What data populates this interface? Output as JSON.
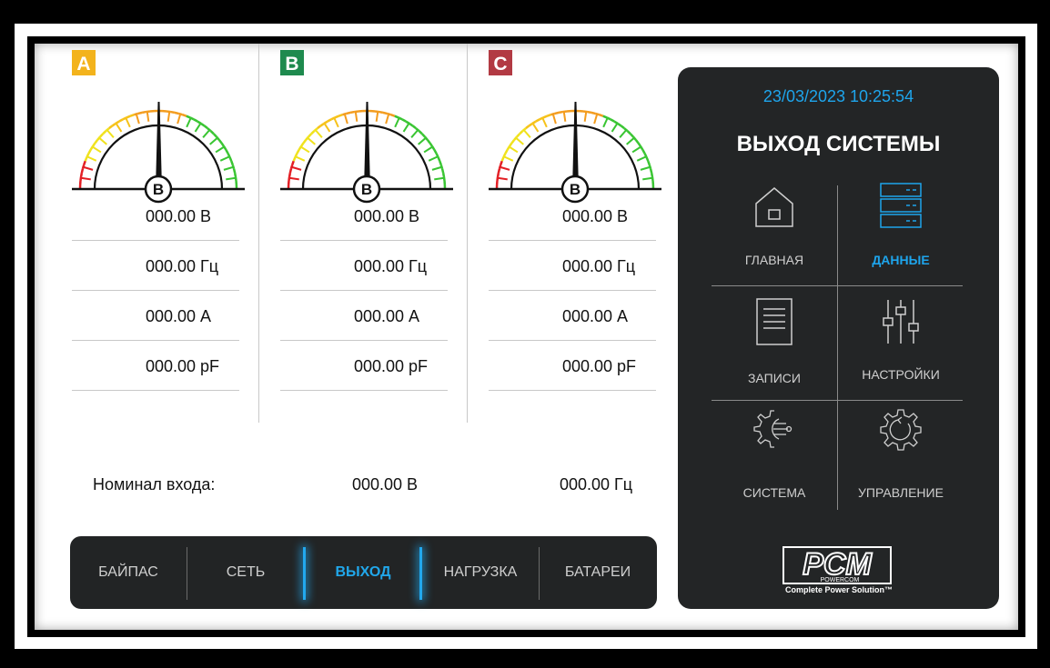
{
  "phases": [
    {
      "badge": "A",
      "color": "#f3b31c",
      "gauge_label": "B",
      "rows": [
        {
          "value": "000.00",
          "unit": "В"
        },
        {
          "value": "000.00",
          "unit": "Гц"
        },
        {
          "value": "000.00",
          "unit": "А"
        },
        {
          "value": "000.00",
          "unit": "pF"
        }
      ]
    },
    {
      "badge": "B",
      "color": "#1e8a4e",
      "gauge_label": "B",
      "rows": [
        {
          "value": "000.00",
          "unit": "В"
        },
        {
          "value": "000.00",
          "unit": "Гц"
        },
        {
          "value": "000.00",
          "unit": "А"
        },
        {
          "value": "000.00",
          "unit": "pF"
        }
      ]
    },
    {
      "badge": "C",
      "color": "#b23a43",
      "gauge_label": "B",
      "rows": [
        {
          "value": "000.00",
          "unit": "В"
        },
        {
          "value": "000.00",
          "unit": "Гц"
        },
        {
          "value": "000.00",
          "unit": "А"
        },
        {
          "value": "000.00",
          "unit": "pF"
        }
      ]
    }
  ],
  "nominal": {
    "label": "Номинал входа:",
    "voltage": "000.00 В",
    "frequency": "000.00 Гц"
  },
  "bottom_nav": {
    "items": [
      "БАЙПАС",
      "СЕТЬ",
      "ВЫХОД",
      "НАГРУЗКА",
      "БАТАРЕИ"
    ],
    "active": "ВЫХОД"
  },
  "panel": {
    "datetime": "23/03/2023  10:25:54",
    "title": "ВЫХОД СИСТЕМЫ",
    "tiles": [
      {
        "label": "ГЛАВНАЯ",
        "icon": "home-icon"
      },
      {
        "label": "ДАННЫЕ",
        "icon": "data-server-icon"
      },
      {
        "label": "ЗАПИСИ",
        "icon": "records-icon"
      },
      {
        "label": "НАСТРОЙКИ",
        "icon": "sliders-icon"
      },
      {
        "label": "СИСТЕМА",
        "icon": "system-gear-icon"
      },
      {
        "label": "УПРАВЛЕНИЕ",
        "icon": "control-gear-icon"
      }
    ],
    "active_tile": "ДАННЫЕ",
    "logo_text": "PCM",
    "logo_brand": "POWERCOM",
    "logo_tagline": "Complete Power Solution™"
  },
  "colors": {
    "accent": "#1ea5ec",
    "panel_bg": "#232526",
    "nav_bg": "#222425"
  }
}
